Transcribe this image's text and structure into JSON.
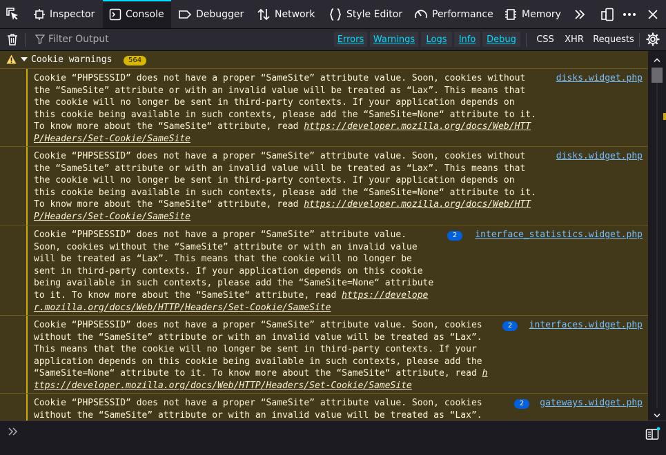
{
  "toolbar": {
    "tabs": [
      {
        "label": "Inspector",
        "icon": "inspector-icon"
      },
      {
        "label": "Console",
        "icon": "console-icon",
        "selected": true
      },
      {
        "label": "Debugger",
        "icon": "debugger-icon"
      },
      {
        "label": "Network",
        "icon": "network-icon"
      },
      {
        "label": "Style Editor",
        "icon": "style-editor-icon"
      },
      {
        "label": "Performance",
        "icon": "performance-icon"
      },
      {
        "label": "Memory",
        "icon": "memory-icon"
      }
    ]
  },
  "filter": {
    "placeholder": "Filter Output",
    "levels": [
      "Errors",
      "Warnings",
      "Logs",
      "Info",
      "Debug"
    ],
    "types": [
      "CSS",
      "XHR",
      "Requests"
    ]
  },
  "group": {
    "label": "Cookie warnings",
    "count": "564"
  },
  "messages": [
    {
      "lines": [
        "Cookie “PHPSESSID” does not have a proper “SameSite” attribute value. Soon, cookies without",
        "the “SameSite” attribute or with an invalid value will be treated as “Lax”. This means that",
        "the cookie will no longer be sent in third-party contexts. If your application depends on",
        "this cookie being available in such contexts, please add the “SameSite=None“ attribute to it."
      ],
      "link_prefix": "To know more about the “SameSite“ attribute, read ",
      "link_line1": "https://developer.mozilla.org/docs/Web/HTT",
      "link_line2": "P/Headers/Set-Cookie/SameSite",
      "source": "disks.widget.php",
      "repeat": ""
    },
    {
      "lines": [
        "Cookie “PHPSESSID” does not have a proper “SameSite” attribute value. Soon, cookies without",
        "the “SameSite” attribute or with an invalid value will be treated as “Lax”. This means that",
        "the cookie will no longer be sent in third-party contexts. If your application depends on",
        "this cookie being available in such contexts, please add the “SameSite=None“ attribute to it."
      ],
      "link_prefix": "To know more about the “SameSite“ attribute, read ",
      "link_line1": "https://developer.mozilla.org/docs/Web/HTT",
      "link_line2": "P/Headers/Set-Cookie/SameSite",
      "source": "disks.widget.php",
      "repeat": ""
    },
    {
      "lines": [
        "Cookie “PHPSESSID” does not have a proper “SameSite” attribute value.",
        "Soon, cookies without the “SameSite” attribute or with an invalid value",
        "will be treated as “Lax”. This means that the cookie will no longer be",
        "sent in third-party contexts. If your application depends on this cookie",
        "being available in such contexts, please add the “SameSite=None“ attribute"
      ],
      "link_prefix": "to it. To know more about the “SameSite“ attribute, read ",
      "link_line1": "https://develope",
      "link_line2": "r.mozilla.org/docs/Web/HTTP/Headers/Set-Cookie/SameSite",
      "source": "interface_statistics.widget.php",
      "repeat": "2"
    },
    {
      "lines": [
        "Cookie “PHPSESSID” does not have a proper “SameSite” attribute value. Soon, cookies",
        "without the “SameSite” attribute or with an invalid value will be treated as “Lax”.",
        "This means that the cookie will no longer be sent in third-party contexts. If your",
        "application depends on this cookie being available in such contexts, please add the"
      ],
      "link_prefix": "“SameSite=None“ attribute to it. To know more about the “SameSite“ attribute, read ",
      "link_line1": "h",
      "link_line2": "ttps://developer.mozilla.org/docs/Web/HTTP/Headers/Set-Cookie/SameSite",
      "source": "interfaces.widget.php",
      "repeat": "2"
    },
    {
      "lines": [
        "Cookie “PHPSESSID” does not have a proper “SameSite” attribute value. Soon, cookies",
        "without the “SameSite” attribute or with an invalid value will be treated as “Lax”."
      ],
      "link_prefix": "",
      "link_line1": "",
      "link_line2": "",
      "source": "gateways.widget.php",
      "repeat": "2"
    }
  ]
}
